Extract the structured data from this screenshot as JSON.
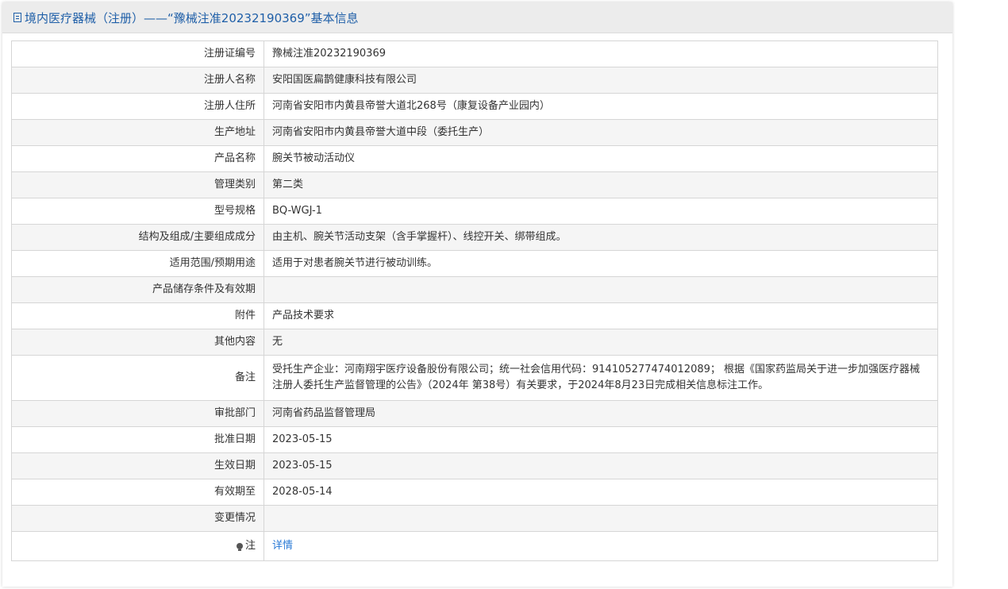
{
  "header": {
    "title": "境内医疗器械（注册）——“豫械注准20232190369”基本信息"
  },
  "rows": [
    {
      "label": "注册证编号",
      "value": "豫械注准20232190369"
    },
    {
      "label": "注册人名称",
      "value": "安阳国医扁鹊健康科技有限公司"
    },
    {
      "label": "注册人住所",
      "value": "河南省安阳市内黄县帝誉大道北268号（康复设备产业园内）"
    },
    {
      "label": "生产地址",
      "value": "河南省安阳市内黄县帝誉大道中段（委托生产）"
    },
    {
      "label": "产品名称",
      "value": "腕关节被动活动仪"
    },
    {
      "label": "管理类别",
      "value": "第二类"
    },
    {
      "label": "型号规格",
      "value": "BQ-WGJ-1"
    },
    {
      "label": "结构及组成/主要组成成分",
      "value": "由主机、腕关节活动支架（含手掌握杆）、线控开关、绑带组成。"
    },
    {
      "label": "适用范围/预期用途",
      "value": "适用于对患者腕关节进行被动训练。"
    },
    {
      "label": "产品储存条件及有效期",
      "value": ""
    },
    {
      "label": "附件",
      "value": "产品技术要求"
    },
    {
      "label": "其他内容",
      "value": "无"
    },
    {
      "label": "备注",
      "value": "受托生产企业：河南翔宇医疗设备股份有限公司；统一社会信用代码：914105277474012089； 根据《国家药监局关于进一步加强医疗器械注册人委托生产监督管理的公告》（2024年 第38号）有关要求，于2024年8月23日完成相关信息标注工作。"
    },
    {
      "label": "审批部门",
      "value": "河南省药品监督管理局"
    },
    {
      "label": "批准日期",
      "value": "2023-05-15"
    },
    {
      "label": "生效日期",
      "value": "2023-05-15"
    },
    {
      "label": "有效期至",
      "value": "2028-05-14"
    },
    {
      "label": "变更情况",
      "value": ""
    }
  ],
  "note_row": {
    "label": "注",
    "icon": "lightbulb-icon",
    "link_text": "详情"
  },
  "colors": {
    "title": "#1f5fa8",
    "link": "#2a7ad6",
    "header_bg": "#ececec",
    "row_alt_bg": "#f5f5f5"
  }
}
